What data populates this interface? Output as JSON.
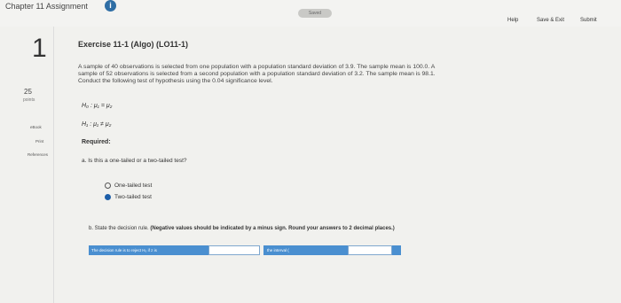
{
  "header": {
    "chapter_title": "Chapter 11 Assignment",
    "info_glyph": "i",
    "saved_label": "Saved",
    "help_label": "Help",
    "save_exit_label": "Save & Exit",
    "submit_label": "Submit"
  },
  "sidebar": {
    "question_number": "1",
    "points_value": "25",
    "points_label": "points",
    "ebook_label": "eBook",
    "print_label": "Print",
    "references_label": "References"
  },
  "exercise": {
    "title": "Exercise 11-1 (Algo) (LO11-1)",
    "problem_line1": "A sample of 40 observations is selected from one population with a population standard deviation of 3.9. The sample mean is 100.0. A",
    "problem_line2": "sample of 52 observations is selected from a second population with a population standard deviation of 3.2. The sample mean is 98.1.",
    "problem_line3": "Conduct the following test of hypothesis using the 0.04 significance level.",
    "h0": "H₀ : μ₁ = μ₂",
    "h1": "H₁ : μ₁ ≠ μ₂",
    "required_label": "Required:",
    "question_a": "a. Is this a one-tailed or a two-tailed test?",
    "options": [
      {
        "label": "One-tailed test",
        "selected": false
      },
      {
        "label": "Two-tailed test",
        "selected": true
      }
    ],
    "question_b_prefix": "b. State the decision rule.",
    "question_b_emphasis": "(Negative values should be indicated by a minus sign. Round your answers to 2 decimal places.)",
    "decision_rule_text": "The decision rule is to reject H₀ if z is",
    "interval_text": "the interval ("
  }
}
